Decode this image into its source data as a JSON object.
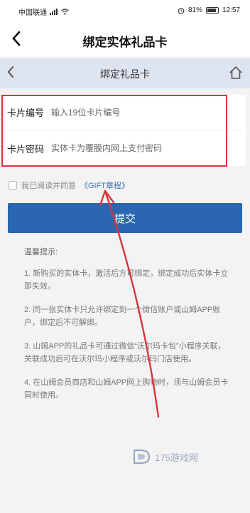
{
  "status_bar": {
    "carrier": "中国联通",
    "battery": "81%",
    "time": "12:57"
  },
  "header": {
    "back_icon": "chevron-left-icon",
    "title": "绑定实体礼品卡"
  },
  "sub_header": {
    "back_icon": "chevron-left-icon",
    "title": "绑定礼品卡",
    "home_icon": "home-icon"
  },
  "form": {
    "card_number": {
      "label": "卡片编号",
      "placeholder": "输入19位卡片编号",
      "value": ""
    },
    "card_password": {
      "label": "卡片密码",
      "placeholder": "实体卡为覆膜内网上支付密码",
      "value": ""
    }
  },
  "agreement": {
    "text": "我已阅读并同意",
    "link": "《GIFT章程》",
    "checked": false
  },
  "submit": {
    "label": "提交"
  },
  "tips": {
    "title": "温馨提示:",
    "items": [
      "1. 新购买的实体卡，激活后方可绑定，绑定成功后实体卡立即失效。",
      "2. 同一张实体卡只允许绑定到一个微信账户或山姆APP账户，绑定后不可解绑。",
      "3. 山姆APP的礼品卡可通过微信“沃尔玛卡包”小程序关联，关联成功后可在沃尔玛小程序或沃尔玛门店使用。",
      "4. 在山姆会员商店和山姆APP网上购物时，须与山姆会员卡同时使用。"
    ]
  },
  "annotation": {
    "highlight_color": "#d9343b",
    "arrow_color": "#d9343b"
  },
  "watermark": {
    "text": "175游戏网"
  },
  "colors": {
    "primary": "#2b66b0",
    "sub_header_bg": "#dde4ef",
    "link": "#3b6fb3"
  }
}
